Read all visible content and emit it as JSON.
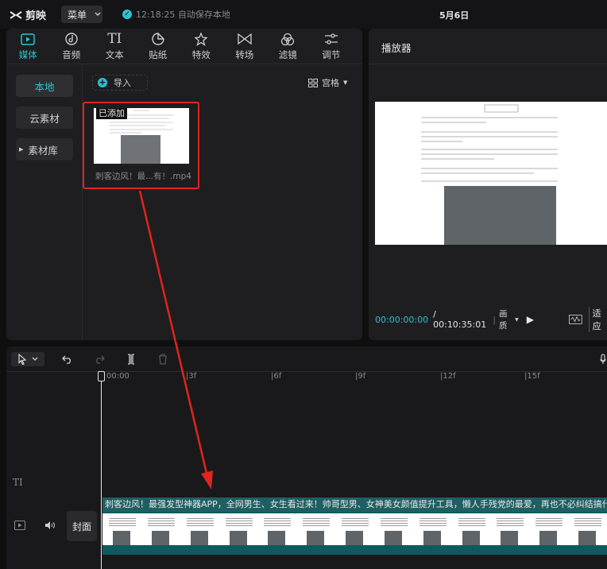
{
  "app": {
    "name": "剪映",
    "menu_label": "菜单",
    "autosave_text": "12:18:25 自动保存本地",
    "doc_title": "5月6日"
  },
  "tabs": [
    {
      "label": "媒体",
      "icon": "media-icon",
      "active": true
    },
    {
      "label": "音频",
      "icon": "audio-icon"
    },
    {
      "label": "文本",
      "icon": "text-icon"
    },
    {
      "label": "贴纸",
      "icon": "sticker-icon"
    },
    {
      "label": "特效",
      "icon": "effect-icon"
    },
    {
      "label": "转场",
      "icon": "transition-icon"
    },
    {
      "label": "滤镜",
      "icon": "filter-icon"
    },
    {
      "label": "调节",
      "icon": "adjust-icon"
    }
  ],
  "sidebar": {
    "items": [
      {
        "label": "本地"
      },
      {
        "label": "云素材"
      },
      {
        "label": "素材库"
      }
    ]
  },
  "media": {
    "import_label": "导入",
    "view_label": "宫格",
    "item": {
      "badge": "已添加",
      "name": "刺客边风！最...有！.mp4"
    }
  },
  "player": {
    "title": "播放器",
    "current_time": "00:00:00:00",
    "total_time": "/ 00:10:35:01",
    "quality_label": "画质",
    "fit_label": "适应"
  },
  "timeline": {
    "ruler_labels": [
      "00:00",
      "3f",
      "6f",
      "9f",
      "12f",
      "15f"
    ],
    "cover_label": "封面",
    "text_clip": "刺客边风！最强发型神器APP，全网男生、女生看过来！帅哥型男、女神美女颜值提升工具，懒人手残党的最爱，再也不必纠结搞什么发型，选"
  },
  "colors": {
    "accent": "#2ec0d0",
    "highlight": "#e0241e",
    "clip_teal": "#1f5f63"
  }
}
